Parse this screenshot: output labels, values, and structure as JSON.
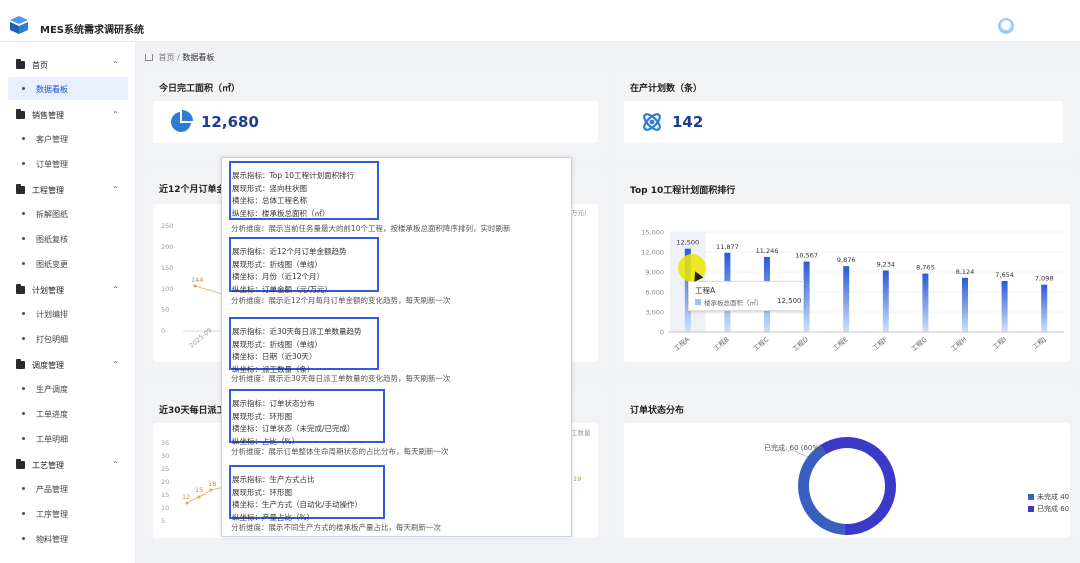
{
  "header": {
    "app_title": "MES系统需求调研系统"
  },
  "sidebar": {
    "groups": [
      {
        "label": "首页",
        "items": [
          "数据看板"
        ]
      },
      {
        "label": "销售管理",
        "items": [
          "客户管理",
          "订单管理"
        ]
      },
      {
        "label": "工程管理",
        "items": [
          "拆解图纸",
          "图纸复核",
          "图纸变更"
        ]
      },
      {
        "label": "计划管理",
        "items": [
          "计划编排",
          "打包明细"
        ]
      },
      {
        "label": "调度管理",
        "items": [
          "生产调度",
          "工单进度",
          "工单明细"
        ]
      },
      {
        "label": "工艺管理",
        "items": [
          "产品管理",
          "工序管理",
          "物料管理"
        ]
      }
    ],
    "active_item": "数据看板"
  },
  "breadcrumb": {
    "home": "首页",
    "sep": "/",
    "current": "数据看板"
  },
  "stats": {
    "today_area": {
      "title": "今日完工面积（㎡）",
      "value": "12,680"
    },
    "in_production": {
      "title": "在产计划数（条）",
      "value": "142"
    }
  },
  "cards": {
    "monthly_orders_title": "近12个月订单金",
    "top10_title": "Top 10工程计划面积排行",
    "daily_orders_title": "近30天每日派工",
    "order_status_title": "订单状态分布"
  },
  "notes": [
    {
      "lines": [
        "展示指标：Top 10工程计划面积排行",
        "展现形式：竖向柱状图",
        "横坐标：总体工程名称",
        "纵坐标：楼承板总面积（㎡）"
      ],
      "analysis": "分析维度：展示当前任务量最大的前10个工程，按楼承板总面积降序排列，实时刷新"
    },
    {
      "lines": [
        "展示指标：近12个月订单金额趋势",
        "展现形式：折线图（单线）",
        "横坐标：月份（近12个月）",
        "纵坐标：订单金额（元/万元）"
      ],
      "analysis": "分析维度：展示近12个月每月订单金额的变化趋势，每天刷新一次"
    },
    {
      "lines": [
        "展示指标：近30天每日派工单数量趋势",
        "展现形式：折线图（单线）",
        "横坐标：日期（近30天）",
        "纵坐标：派工数量（条）"
      ],
      "analysis": "分析维度：展示近30天每日派工单数量的变化趋势，每天刷新一次"
    },
    {
      "lines": [
        "展示指标：订单状态分布",
        "展现形式：环形图",
        "横坐标：订单状态（未完成/已完成）",
        "纵坐标：占比（%）"
      ],
      "analysis": "分析维度：展示订单整体生命周期状态的占比分布，每天刷新一次"
    },
    {
      "lines": [
        "展示指标：生产方式占比",
        "展现形式：环形图",
        "横坐标：生产方式（自动化/手动操作）",
        "纵坐标：产量占比（%）"
      ],
      "analysis": "分析维度：展示不同生产方式的楼承板产量占比，每天刷新一次"
    }
  ],
  "partial_left": {
    "monthly": {
      "y_ticks": [
        "250",
        "200",
        "150",
        "100",
        "50",
        "0"
      ],
      "point_label": "144",
      "x_tick": "2025-09",
      "unit_fragment": "万元)"
    },
    "daily": {
      "y_ticks": [
        "35",
        "30",
        "25",
        "20",
        "15",
        "10",
        "5"
      ],
      "point_labels": [
        "12",
        "15",
        "18"
      ],
      "right_label": "19",
      "unit_fragment": "工数量"
    }
  },
  "chart_data": [
    {
      "type": "bar",
      "title": "Top 10工程计划面积排行",
      "categories": [
        "工程A",
        "工程B",
        "工程C",
        "工程D",
        "工程E",
        "工程F",
        "工程G",
        "工程H",
        "工程I",
        "工程J"
      ],
      "series": [
        {
          "name": "楼承板总面积（㎡）",
          "values": [
            12500,
            11877,
            11246,
            10567,
            9876,
            9234,
            8765,
            8124,
            7654,
            7098
          ]
        }
      ],
      "data_labels": [
        "12,500",
        "11,877",
        "11,246",
        "10,567",
        "9,876",
        "9,234",
        "8,765",
        "8,124",
        "7,654",
        "7,098"
      ],
      "y_ticks": [
        "15,000",
        "12,000",
        "9,000",
        "6,000",
        "3,000",
        "0"
      ],
      "ylim": [
        0,
        15000
      ],
      "grid": true,
      "tooltip": {
        "title": "工程A",
        "label": "楼承板总面积（㎡）",
        "value": "12,500"
      },
      "colors": {
        "bar_top": "#2a5bd7",
        "bar_bottom": "#cfe1fb"
      }
    },
    {
      "type": "pie",
      "title": "订单状态分布",
      "donut": true,
      "categories": [
        "未完成",
        "已完成"
      ],
      "values": [
        40,
        60
      ],
      "slice_label": "已完成: 60 (60%)",
      "legend": [
        {
          "label": "未完成 40",
          "color": "#3a5fc0"
        },
        {
          "label": "已完成 60",
          "color": "#3a39c8"
        }
      ],
      "legend_position": "right"
    }
  ]
}
